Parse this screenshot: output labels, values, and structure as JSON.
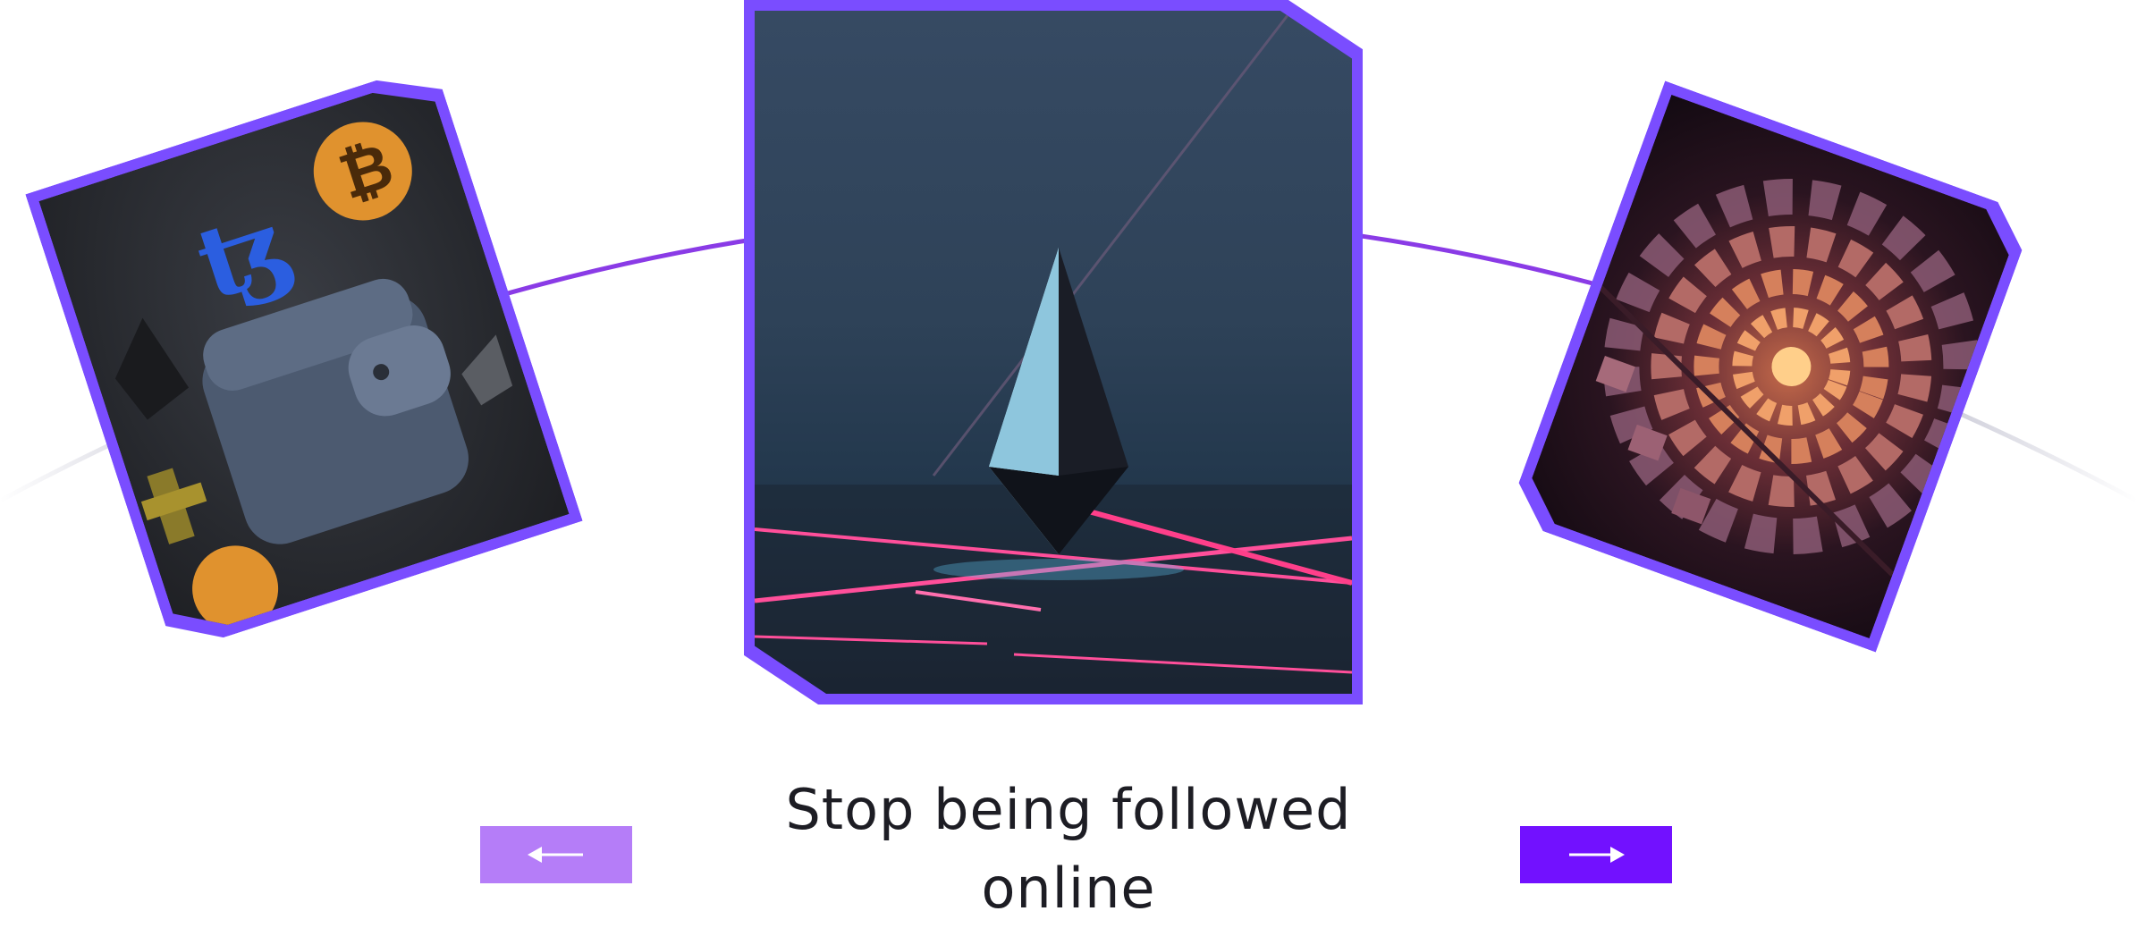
{
  "carousel": {
    "caption": "Stop being followed online",
    "prev_icon": "arrow-left-icon",
    "next_icon": "arrow-right-icon",
    "cards": [
      {
        "name": "card-left-wallet",
        "image": "crypto-wallet-image"
      },
      {
        "name": "card-center-crystal",
        "image": "crystal-prism-image"
      },
      {
        "name": "card-right-tunnel",
        "image": "cube-tunnel-image"
      }
    ]
  },
  "colors": {
    "accent": "#7a4dff",
    "prev_button": "#b57df8",
    "next_button": "#7211ff",
    "arc": "#7a3fe0",
    "text": "#1d1d24",
    "background": "#ffffff"
  }
}
